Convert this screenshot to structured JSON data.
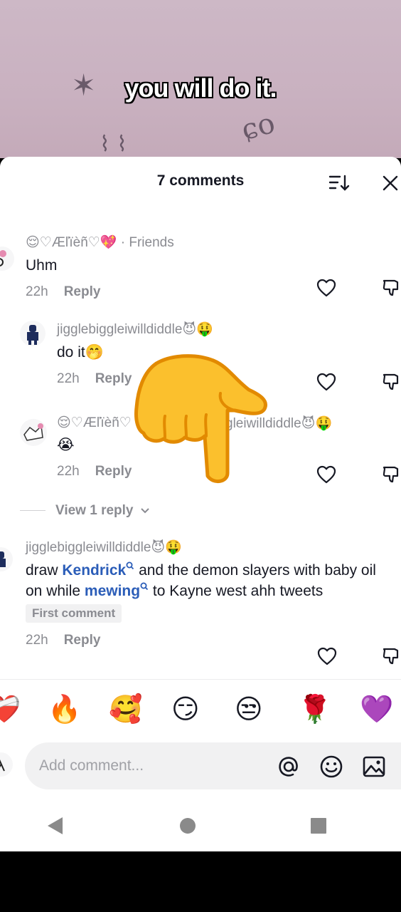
{
  "video": {
    "caption": "you will do it."
  },
  "comments_panel": {
    "title": "7 comments"
  },
  "comments": [
    {
      "username": "😌♡Æľïèñ♡💖",
      "tag": "Friends",
      "text": "Uhm",
      "time": "22h",
      "reply_label": "Reply"
    },
    {
      "username": "jigglebiggleiwilldiddle😈🤑",
      "text": "do it🤭",
      "time": "22h",
      "reply_label": "Reply"
    },
    {
      "username_start": "😌♡Æľïèñ♡",
      "username_end": "gleiwilldiddle😈🤑",
      "text": "😭",
      "time": "22h",
      "reply_label": "Reply"
    }
  ],
  "view_replies": "View 1 reply",
  "comment4": {
    "username": "jigglebiggleiwilldiddle😈🤑",
    "text_1": "draw ",
    "link_1": "Kendrick",
    "text_2": " and the demon slayers with baby oil on while ",
    "link_2": "mewing",
    "text_3": " to Kayne west ahh tweets",
    "badge": "First comment",
    "time": "22h",
    "reply_label": "Reply"
  },
  "emoji_bar": [
    "❤️‍🩹",
    "🔥",
    "🥰",
    "😏",
    "😒",
    "🌹",
    "💜"
  ],
  "composer": {
    "placeholder": "Add comment..."
  },
  "icons": {
    "sort": "sort-icon",
    "close": "close-icon",
    "like": "heart-outline-icon",
    "dislike": "thumbs-down-icon",
    "mention": "at-sign-icon",
    "emoji": "smiley-icon",
    "image": "image-icon",
    "nav": [
      "back-triangle-icon",
      "home-circle-icon",
      "recents-square-icon"
    ]
  },
  "overlay": {
    "sticker": "pointing-hand-emoji"
  }
}
